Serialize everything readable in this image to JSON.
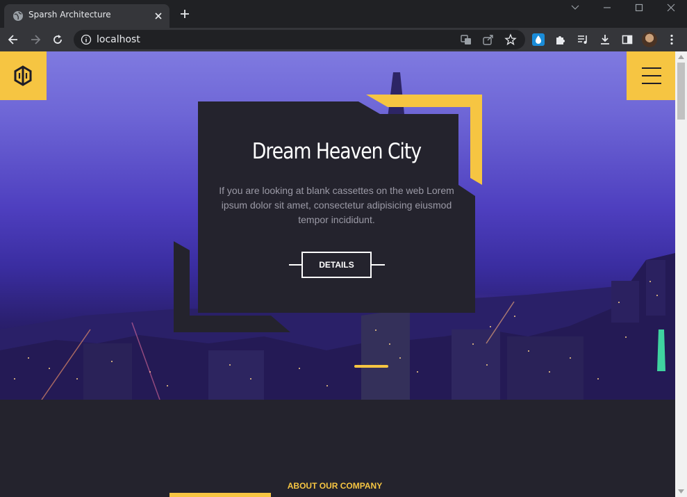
{
  "browser": {
    "tab_title": "Sparsh Architecture",
    "url": "localhost"
  },
  "hero": {
    "title": "Dream Heaven City",
    "description": "If you are looking at blank cassettes on the web Lorem ipsum dolor sit amet, consectetur adipisicing eiusmod tempor incididunt.",
    "button_label": "DETAILS"
  },
  "about": {
    "heading": "ABOUT OUR COMPANY"
  },
  "colors": {
    "accent": "#f6c542",
    "card": "#24232d",
    "chrome": "#35363a",
    "chrome_dark": "#202124"
  },
  "icons": {
    "tab_favicon": "globe-icon",
    "tab_close": "close-icon",
    "new_tab": "plus-icon",
    "logo": "sparsh-logo-icon",
    "menu": "hamburger-menu-icon"
  }
}
